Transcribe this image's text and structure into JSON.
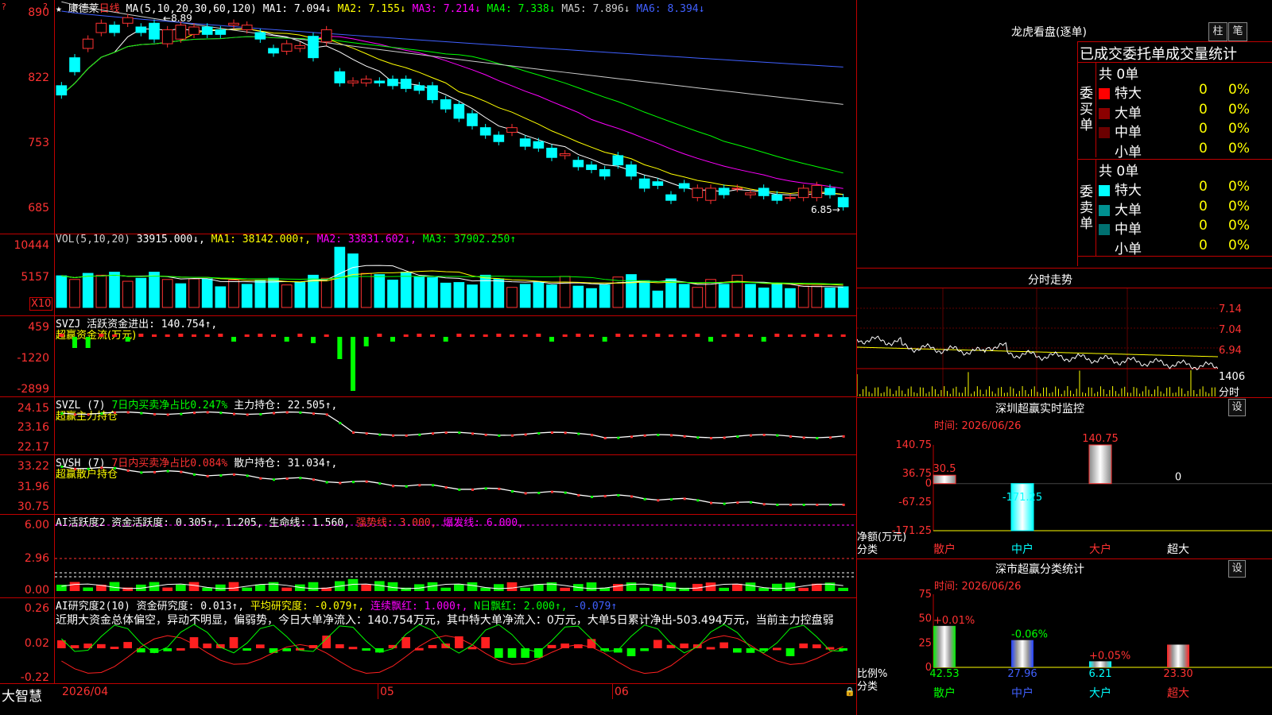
{
  "stock": {
    "name": "康德莱",
    "period": "日线",
    "logo": "大智慧"
  },
  "kline": {
    "header": {
      "ma_params": "MA(5,10,20,30,60,120)",
      "items": [
        {
          "label": "MA1:",
          "value": "7.094↓",
          "color": "#ffffff"
        },
        {
          "label": "MA2:",
          "value": "7.155↓",
          "color": "#ffff00"
        },
        {
          "label": "MA3:",
          "value": "7.214↓",
          "color": "#ff00ff"
        },
        {
          "label": "MA4:",
          "value": "7.338↓",
          "color": "#00ff00"
        },
        {
          "label": "MA5:",
          "value": "7.896↓",
          "color": "#cccccc"
        },
        {
          "label": "MA6:",
          "value": "8.394↓",
          "color": "#4060ff"
        }
      ]
    },
    "y_ticks": [
      "890",
      "822",
      "753",
      "685"
    ],
    "high_marker": "8.89",
    "low_marker": "6.85"
  },
  "vol": {
    "header": [
      {
        "text": "VOL(5,10,20)",
        "color": "#cccccc"
      },
      {
        "text": "33915.000↓,",
        "color": "#ffffff"
      },
      {
        "text": "MA1: 38142.000↑,",
        "color": "#ffff00"
      },
      {
        "text": "MA2: 33831.602↓,",
        "color": "#ff00ff"
      },
      {
        "text": "MA3: 37902.250↑",
        "color": "#00ff00"
      }
    ],
    "y_ticks": [
      "10444",
      "5157"
    ],
    "unit": "X10"
  },
  "svzj": {
    "header": [
      {
        "text": "SVZJ  活跃资金进出: 140.754↑,",
        "color": "#ffffff"
      }
    ],
    "sub": "超赢资金流(万元)",
    "y_ticks": [
      "459",
      "-1220",
      "-2899"
    ]
  },
  "svzl": {
    "header": [
      {
        "text": "SVZL (7)",
        "color": "#ffffff"
      },
      {
        "text": "7日内买卖净占比0.247%",
        "color": "#00ff00"
      },
      {
        "text": "主力持仓: 22.505↑,",
        "color": "#ffffff"
      }
    ],
    "sub": "超赢主力持仓",
    "y_ticks": [
      "24.15",
      "23.16",
      "22.17"
    ]
  },
  "svsh": {
    "header": [
      {
        "text": "SVSH (7)",
        "color": "#ffffff"
      },
      {
        "text": "7日内买卖净占比0.084%",
        "color": "#ff3232"
      },
      {
        "text": "散户持仓: 31.034↑,",
        "color": "#ffffff"
      }
    ],
    "sub": "超赢散户持仓",
    "y_ticks": [
      "33.22",
      "31.96",
      "30.75"
    ]
  },
  "ai_active": {
    "header": [
      {
        "text": "AI活跃度2 资金活跃度: 0.305↑, 1.205, 生命线: 1.560,",
        "color": "#ffffff"
      },
      {
        "text": "强势线: 3.000,",
        "color": "#ff3232"
      },
      {
        "text": "爆发线: 6.000,",
        "color": "#ff00ff"
      }
    ],
    "y_ticks": [
      "6.00",
      "2.96",
      "0.00"
    ]
  },
  "ai_research": {
    "header": [
      {
        "text": "AI研究度2(10) 资金研究度: 0.013↑,",
        "color": "#ffffff"
      },
      {
        "text": "平均研究度: -0.079↑,",
        "color": "#ffff00"
      },
      {
        "text": "连续飘红: 1.000↑,",
        "color": "#ff00ff"
      },
      {
        "text": "N日飘红: 2.000↑,",
        "color": "#00ff00"
      },
      {
        "text": "-0.079↑",
        "color": "#4060ff"
      }
    ],
    "comment": "近期大资金总体偏空，异动不明显，偏弱势，今日大单净流入：140.754万元，其中特大单净流入：0万元，大单5日累计净出-503.494万元，当前主力控盘弱",
    "y_ticks": [
      "0.26",
      "0.02",
      "-0.22"
    ]
  },
  "x_axis": {
    "labels": [
      "2026/04",
      "05",
      "06"
    ]
  },
  "right": {
    "longhu": {
      "title": "龙虎看盘(逐单)",
      "tab_bar": "柱",
      "tab_stroke": "笔",
      "subtitle": "已成交委托单成交量统计",
      "buy": {
        "side_label": "委买单",
        "total": "共 0单",
        "rows": [
          {
            "name": "特大",
            "count": "0",
            "pct": "0%",
            "color": "#ff0000"
          },
          {
            "name": "大单",
            "count": "0",
            "pct": "0%",
            "color": "#8b0000"
          },
          {
            "name": "中单",
            "count": "0",
            "pct": "0%",
            "color": "#6b0000"
          },
          {
            "name": "小单",
            "count": "0",
            "pct": "0%",
            "color": "#000000"
          }
        ]
      },
      "sell": {
        "side_label": "委卖单",
        "total": "共 0单",
        "rows": [
          {
            "name": "特大",
            "count": "0",
            "pct": "0%",
            "color": "#00ffff"
          },
          {
            "name": "大单",
            "count": "0",
            "pct": "0%",
            "color": "#009090"
          },
          {
            "name": "中单",
            "count": "0",
            "pct": "0%",
            "color": "#007070"
          },
          {
            "name": "小单",
            "count": "0",
            "pct": "0%",
            "color": "#000000"
          }
        ]
      }
    },
    "intraday": {
      "title": "分时走势",
      "y_ticks": [
        "7.14",
        "7.04",
        "6.94"
      ],
      "vol_tick": "1406",
      "vol_unit": "分时"
    },
    "monitor": {
      "title": "深圳超赢实时监控",
      "settings": "设",
      "time": "时间: 2026/06/26",
      "y_ticks": [
        "140.75",
        "36.75",
        "0",
        "-67.25",
        "-171.25"
      ],
      "y_label": "净额(万元)",
      "x_label": "分类",
      "bars": [
        {
          "name": "散户",
          "value": 30.5,
          "label": "30.5"
        },
        {
          "name": "中户",
          "value": -171.25,
          "label": "-171.25"
        },
        {
          "name": "大户",
          "value": 140.75,
          "label": "140.75"
        },
        {
          "name": "超大",
          "value": 0,
          "label": "0"
        }
      ]
    },
    "classify": {
      "title": "深市超赢分类统计",
      "settings": "设",
      "time": "时间: 2026/06/26",
      "y_ticks": [
        "75",
        "50",
        "25",
        "0"
      ],
      "y_label": "比例%",
      "x_label": "分类",
      "bars": [
        {
          "name": "散户",
          "value": 42.53,
          "label": "42.53",
          "change": "+0.01%"
        },
        {
          "name": "中户",
          "value": 27.96,
          "label": "27.96",
          "change": "-0.06%"
        },
        {
          "name": "大户",
          "value": 6.21,
          "label": "6.21",
          "change": "+0.05%"
        },
        {
          "name": "超大",
          "value": 23.3,
          "label": "23.30",
          "change": ""
        }
      ]
    }
  },
  "chart_data": [
    {
      "type": "candlestick",
      "title": "康德莱 日线",
      "ylim": [
        6.7,
        8.95
      ],
      "x": [
        "2026/04",
        "05",
        "06"
      ],
      "open": [
        8.15,
        8.45,
        8.55,
        8.72,
        8.8,
        8.82,
        8.78,
        8.82,
        8.6,
        8.65,
        8.7,
        8.78,
        8.75,
        8.8,
        8.75,
        8.72,
        8.55,
        8.52,
        8.55,
        8.68,
        8.62,
        8.3,
        8.18,
        8.18,
        8.2,
        8.22,
        8.22,
        8.15,
        8.15,
        8.0,
        7.95,
        7.85,
        7.7,
        7.62,
        7.65,
        7.58,
        7.55,
        7.48,
        7.4,
        7.35,
        7.3,
        7.25,
        7.4,
        7.3,
        7.15,
        7.12,
        6.98,
        7.1,
        6.95,
        6.92,
        7.05,
        7.05,
        6.98,
        7.05,
        6.98,
        6.95,
        6.95,
        6.95,
        7.05,
        6.95
      ],
      "close": [
        8.05,
        8.3,
        8.65,
        8.82,
        8.72,
        8.88,
        8.72,
        8.65,
        8.75,
        8.8,
        8.78,
        8.7,
        8.7,
        8.82,
        8.8,
        8.65,
        8.5,
        8.6,
        8.58,
        8.45,
        8.75,
        8.18,
        8.2,
        8.22,
        8.18,
        8.15,
        8.12,
        8.1,
        8.0,
        7.9,
        7.8,
        7.72,
        7.62,
        7.55,
        7.7,
        7.5,
        7.48,
        7.38,
        7.42,
        7.28,
        7.25,
        7.18,
        7.3,
        7.18,
        7.05,
        7.08,
        6.92,
        7.05,
        7.05,
        7.05,
        6.98,
        7.05,
        7.0,
        6.97,
        6.92,
        6.95,
        7.05,
        7.08,
        6.98,
        6.85
      ]
    },
    {
      "type": "bar",
      "title": "VOL(5,10,20)",
      "ylim": [
        0,
        10444
      ],
      "values": [
        5200,
        4600,
        5600,
        5300,
        5800,
        4300,
        4800,
        5800,
        4600,
        3900,
        4700,
        4700,
        3400,
        4500,
        3800,
        4500,
        4800,
        3700,
        4100,
        5300,
        4800,
        9900,
        8800,
        5600,
        5400,
        4500,
        5800,
        5100,
        4900,
        4000,
        4100,
        3700,
        5300,
        4700,
        3300,
        3800,
        4100,
        3700,
        5100,
        3500,
        3100,
        3700,
        5000,
        5400,
        4400,
        2700,
        4700,
        3800,
        3300,
        4600,
        3800,
        5300,
        3800,
        3200,
        3800,
        3100,
        3500,
        3500,
        3200,
        3400
      ],
      "up": [
        0,
        1,
        0,
        1,
        0,
        1,
        0,
        0,
        1,
        0,
        1,
        0,
        0,
        1,
        0,
        0,
        0,
        1,
        0,
        0,
        1,
        0,
        0,
        1,
        0,
        0,
        0,
        0,
        0,
        0,
        0,
        0,
        0,
        0,
        1,
        0,
        0,
        0,
        1,
        0,
        0,
        0,
        1,
        0,
        0,
        0,
        0,
        0,
        1,
        1,
        0,
        1,
        0,
        0,
        0,
        0,
        1,
        1,
        0,
        0
      ]
    }
  ]
}
